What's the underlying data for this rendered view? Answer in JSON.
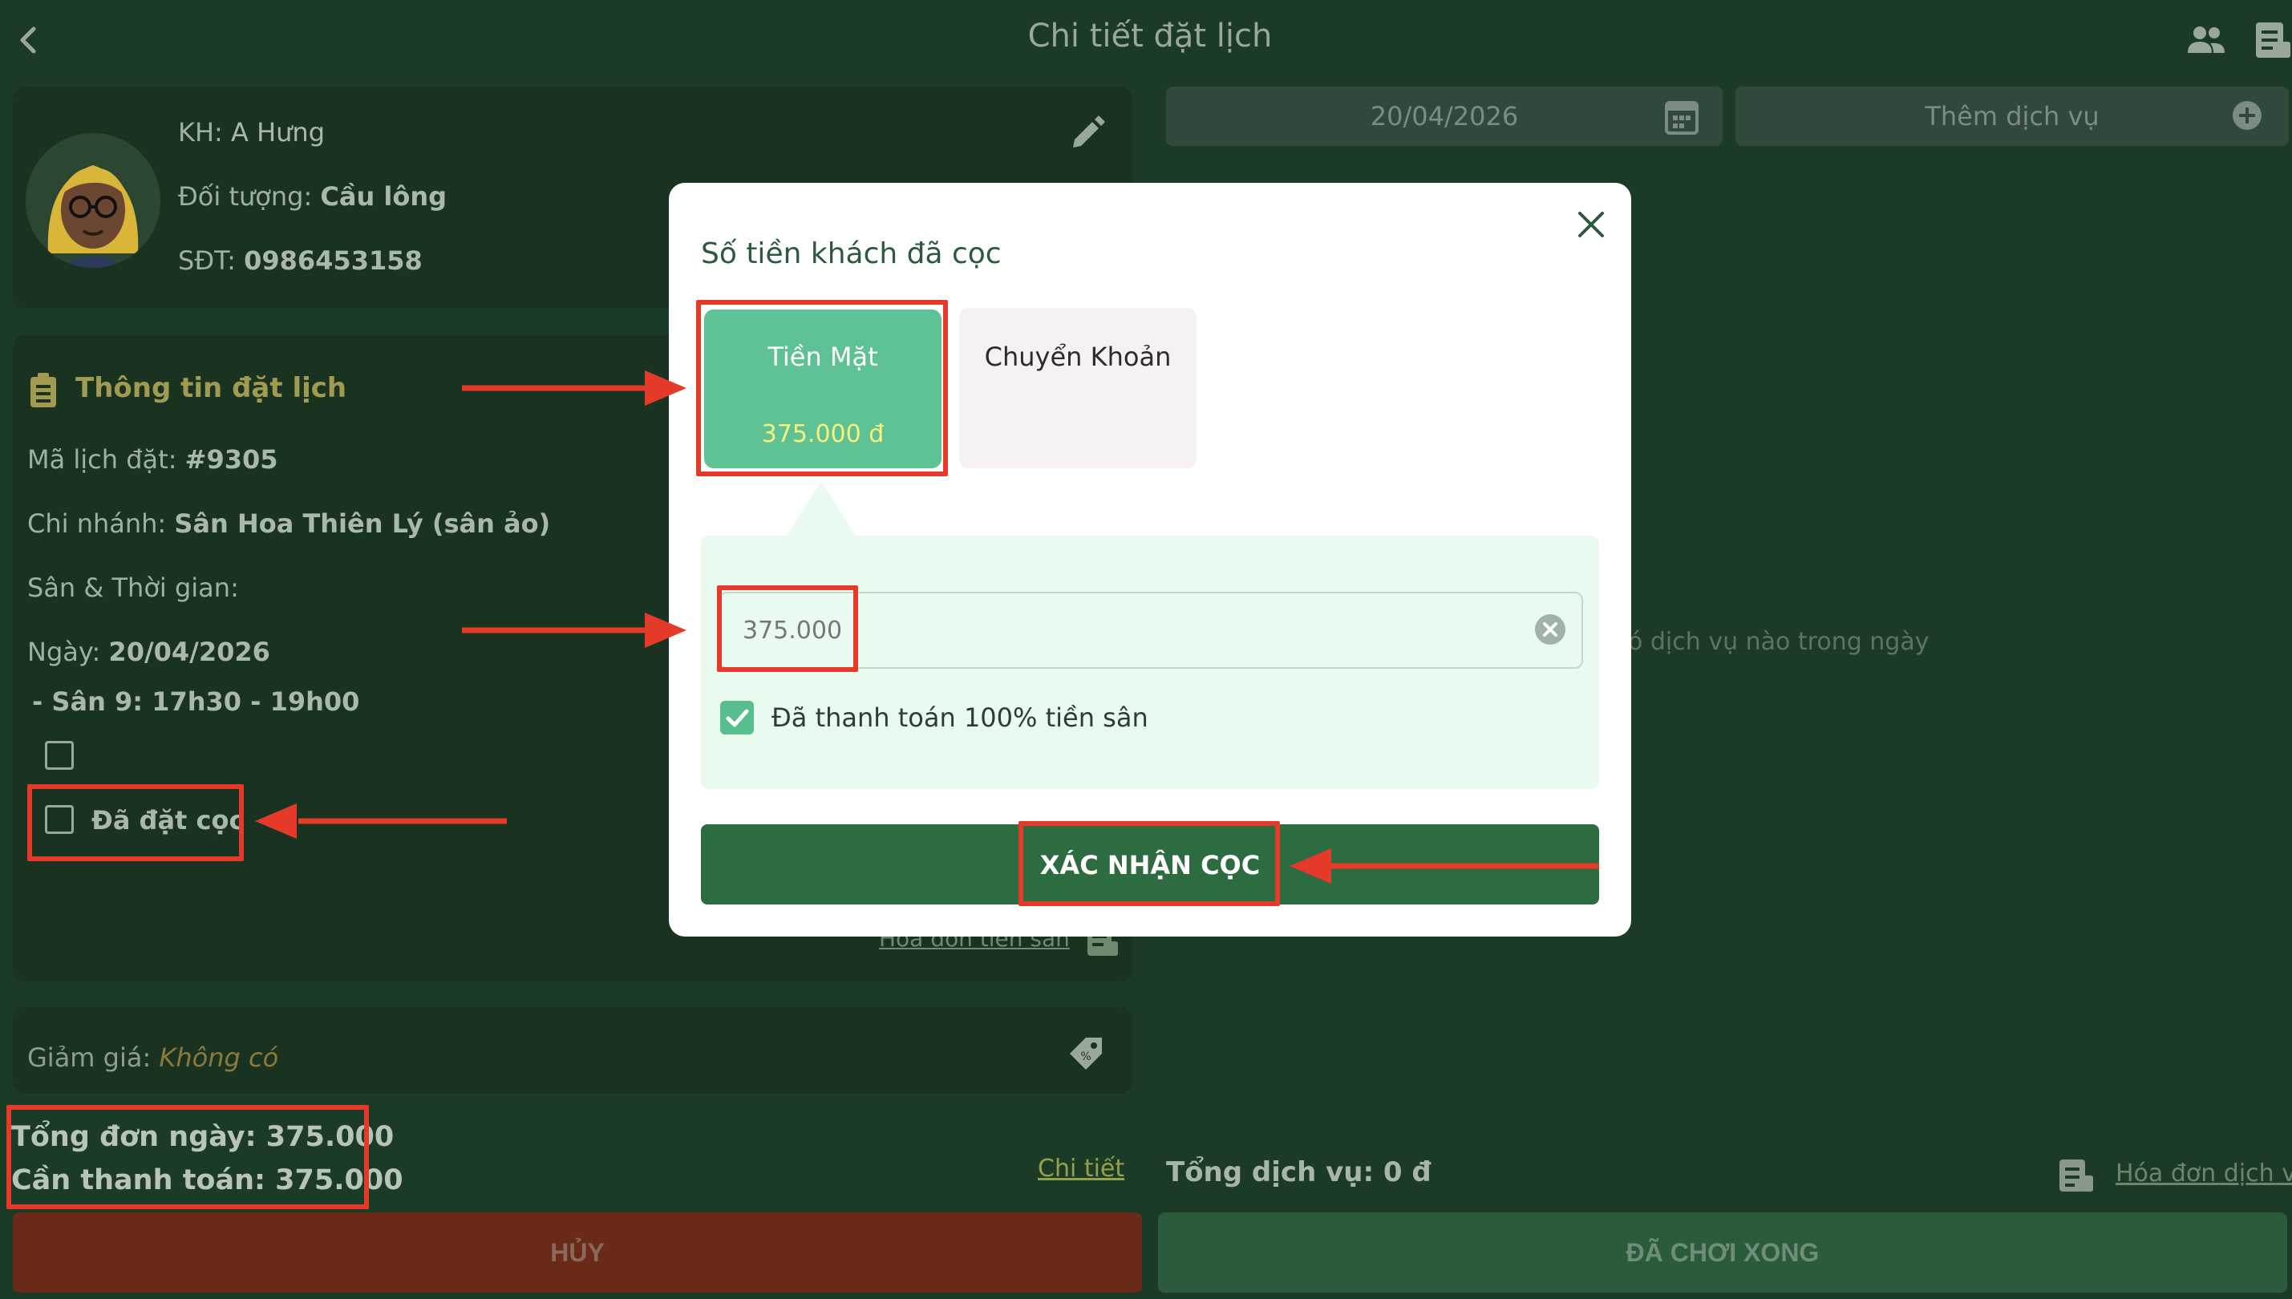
{
  "header": {
    "title": "Chi tiết đặt lịch"
  },
  "customer": {
    "name_label": "KH:",
    "name_value": "A Hưng",
    "target_label": "Đối tượng:",
    "target_value": "Cầu lông",
    "phone_label": "SĐT:",
    "phone_value": "0986453158"
  },
  "booking": {
    "section_title": "Thông tin đặt lịch",
    "code_label": "Mã lịch đặt:",
    "code_value": "#9305",
    "branch_label": "Chi nhánh:",
    "branch_value": "Sân Hoa Thiên Lý (sân ảo)",
    "court_time_label": "Sân & Thời gian:",
    "date_label": "Ngày:",
    "date_value": "20/04/2026",
    "slot": "- Sân 9: 17h30 - 19h00",
    "deposit_checkbox_label": "Đã đặt cọc",
    "invoice_link": "Hóa đơn tiền sân"
  },
  "discount": {
    "label": "Giảm giá:",
    "value": "Không có"
  },
  "totals": {
    "day_total": "Tổng đơn ngày: 375.000",
    "to_pay": "Cần thanh toán: 375.000",
    "detail_link": "Chi tiết"
  },
  "actions": {
    "cancel": "HỦY",
    "done": "ĐÃ CHƠI XONG"
  },
  "right": {
    "date": "20/04/2026",
    "add_service": "Thêm dịch vụ",
    "empty_message": "ó dịch vụ nào trong ngày",
    "service_total": "Tổng dịch vụ: 0 đ",
    "service_invoice_link": "Hóa đơn dịch vụ"
  },
  "modal": {
    "title": "Số tiền khách đã cọc",
    "option_cash_label": "Tiền Mặt",
    "option_cash_amount": "375.000 đ",
    "option_transfer_label": "Chuyển Khoản",
    "amount_value": "375.000",
    "paid_full_label": "Đã thanh toán 100% tiền sân",
    "confirm_label": "XÁC NHẬN CỌC"
  },
  "colors": {
    "background": "#1c3b27",
    "accent_green": "#5ec294",
    "confirm_green": "#2d6b40",
    "cancel_red": "#6b2a17",
    "annotation_red": "#e53a2a",
    "cash_amount_yellow": "#f6f27c"
  },
  "icons": [
    "back-icon",
    "people-icon",
    "document-icon",
    "edit-icon",
    "clipboard-icon",
    "tag-icon",
    "calendar-icon",
    "plus-circle-icon",
    "close-icon",
    "clear-icon",
    "check-icon",
    "invoice-icon"
  ]
}
